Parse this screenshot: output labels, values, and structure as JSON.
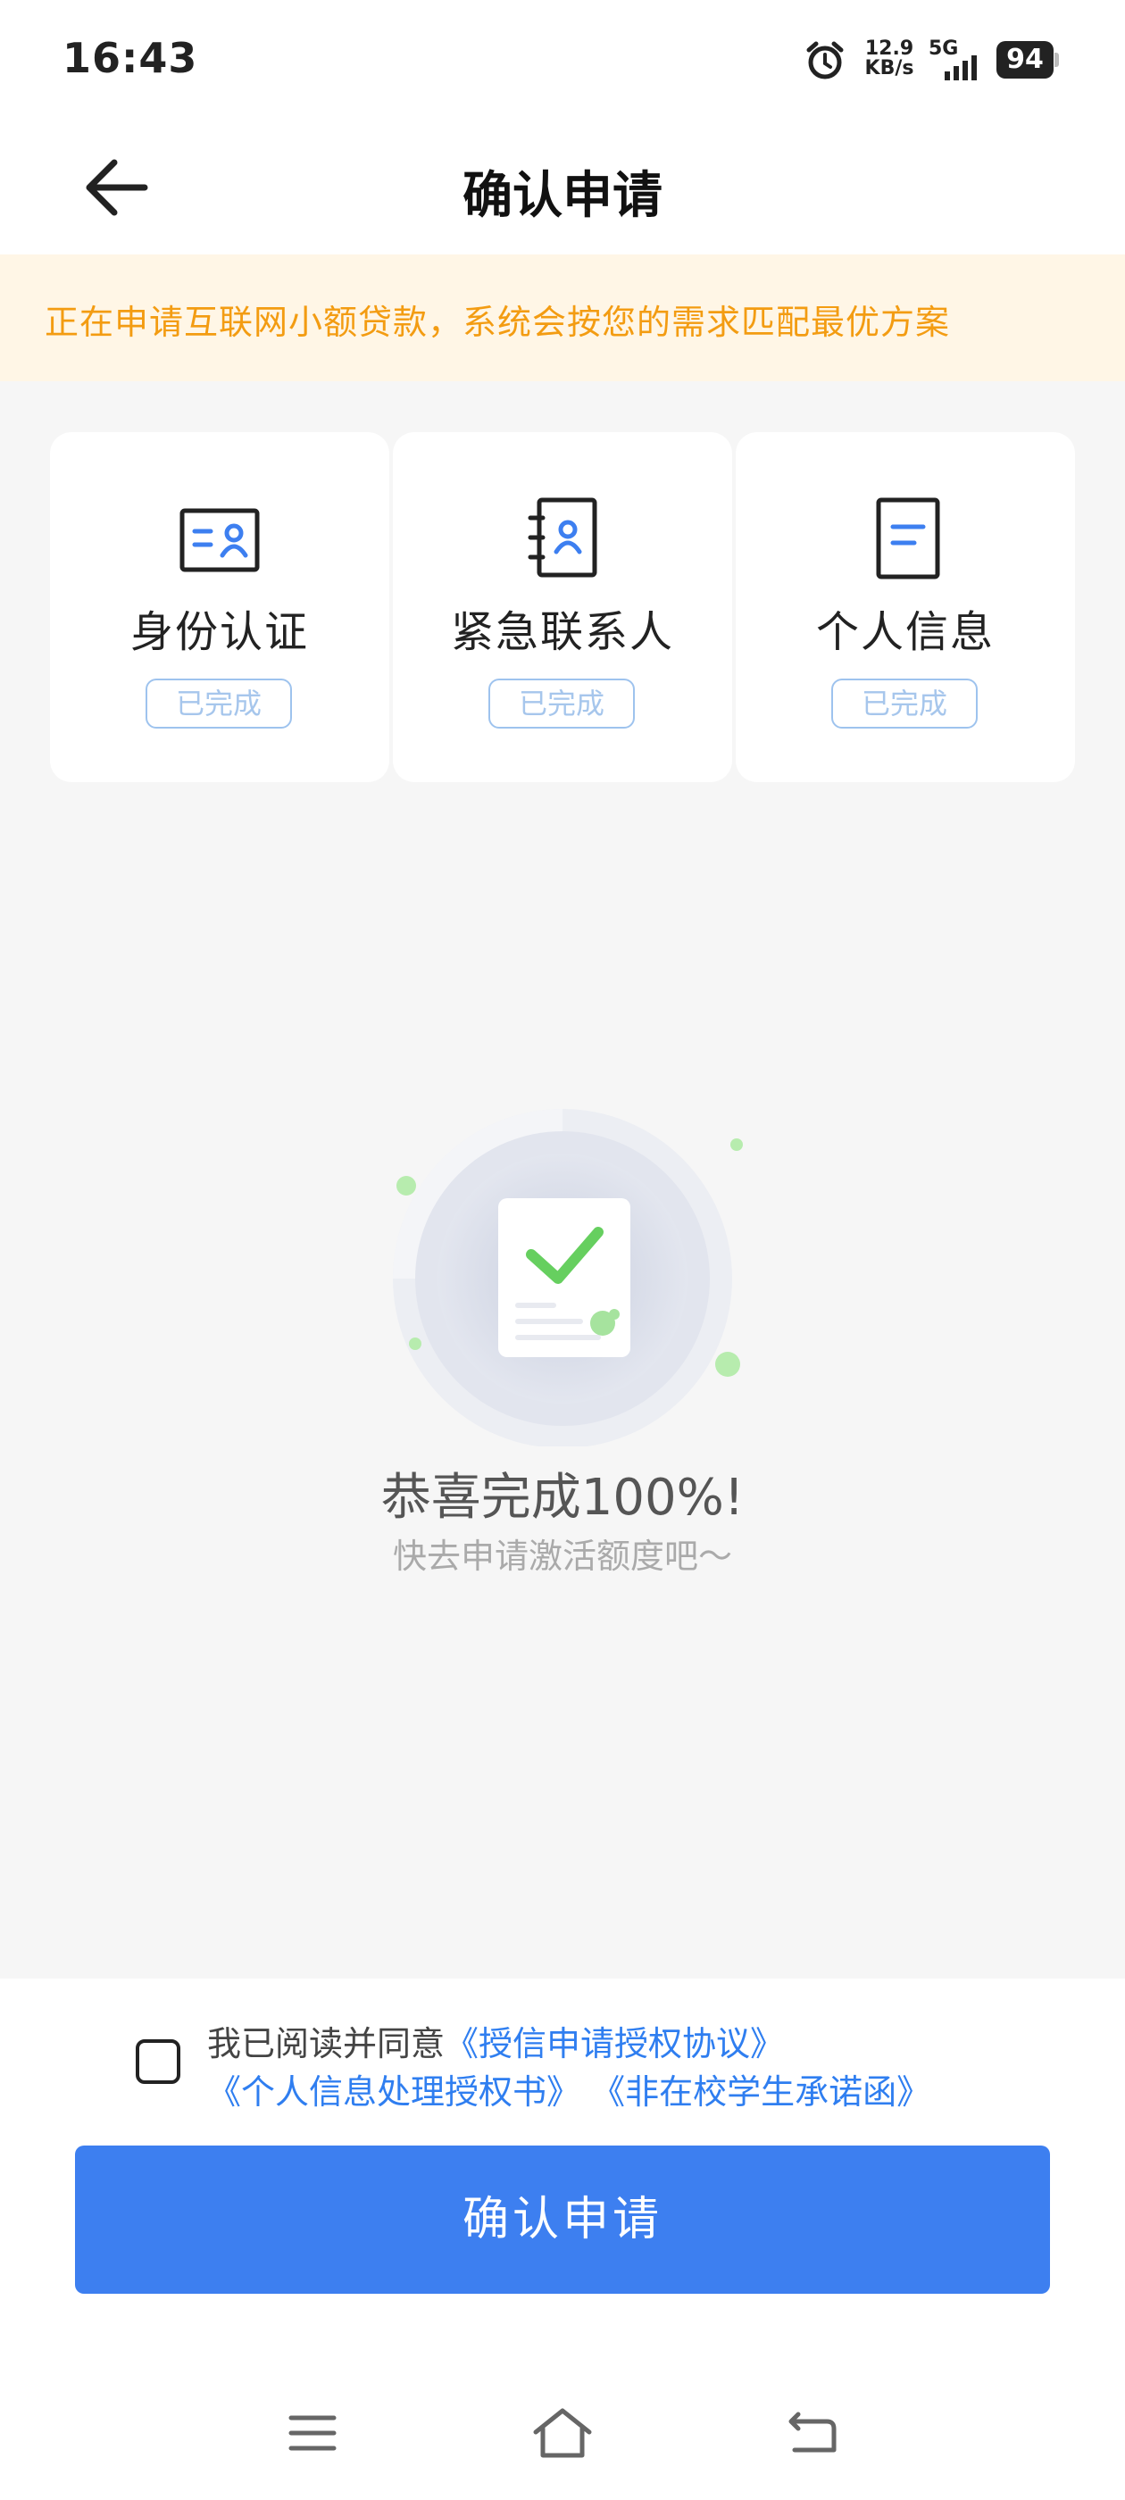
{
  "status_bar": {
    "time": "16:43",
    "speed_value": "12.9",
    "speed_unit": "KB/s",
    "network": "5G",
    "battery": "94"
  },
  "header": {
    "title": "确认申请"
  },
  "notice": {
    "text": "正在申请互联网小额贷款，系统会按您的需求匹配最优方案"
  },
  "steps": [
    {
      "label": "身份认证",
      "status": "已完成",
      "icon": "id-card-icon"
    },
    {
      "label": "紧急联系人",
      "status": "已完成",
      "icon": "contact-book-icon"
    },
    {
      "label": "个人信息",
      "status": "已完成",
      "icon": "document-icon"
    }
  ],
  "completion": {
    "title": "恭喜完成100%!",
    "subtitle": "快去申请激活额度吧～"
  },
  "agreement": {
    "prefix": "我已阅读并同意",
    "link1": "《授信申请授权协议》",
    "link2": "《个人信息处理授权书》",
    "link3": "《非在校学生承诺函》",
    "checked": false
  },
  "confirm_button": "确认申请",
  "colors": {
    "primary": "#3d7ff0",
    "notice_text": "#f39c12",
    "notice_bg": "#fff6e6",
    "badge": "#9ec3ee",
    "check_green": "#5fd35f"
  }
}
